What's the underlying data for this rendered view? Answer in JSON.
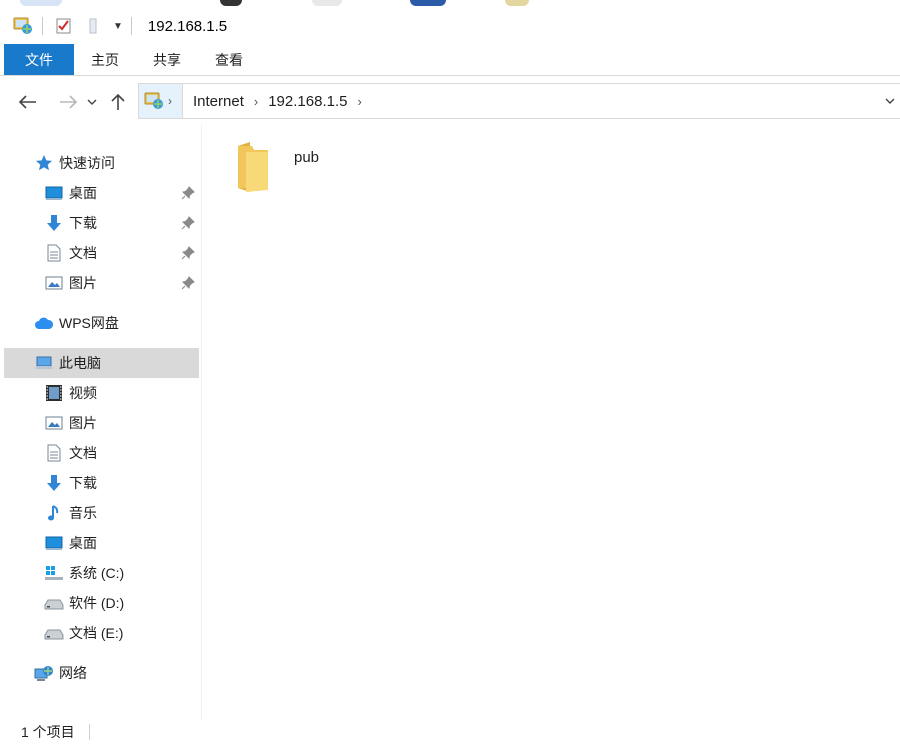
{
  "window": {
    "title": "192.168.1.5"
  },
  "ribbon": {
    "tabs": [
      {
        "label": "文件"
      },
      {
        "label": "主页"
      },
      {
        "label": "共享"
      },
      {
        "label": "查看"
      }
    ]
  },
  "address": {
    "crumbs": [
      "Internet",
      "192.168.1.5"
    ]
  },
  "nav": {
    "quick_access": "快速访问",
    "quick_items": [
      {
        "label": "桌面",
        "icon": "desktop-icon"
      },
      {
        "label": "下载",
        "icon": "download-icon"
      },
      {
        "label": "文档",
        "icon": "document-icon"
      },
      {
        "label": "图片",
        "icon": "pictures-icon"
      }
    ],
    "wps": "WPS网盘",
    "this_pc": "此电脑",
    "pc_items": [
      {
        "label": "视频",
        "icon": "video-icon"
      },
      {
        "label": "图片",
        "icon": "pictures-icon"
      },
      {
        "label": "文档",
        "icon": "document-icon"
      },
      {
        "label": "下载",
        "icon": "download-icon"
      },
      {
        "label": "音乐",
        "icon": "music-icon"
      },
      {
        "label": "桌面",
        "icon": "desktop-icon"
      },
      {
        "label": "系统 (C:)",
        "icon": "system-drive-icon"
      },
      {
        "label": "软件 (D:)",
        "icon": "drive-icon"
      },
      {
        "label": "文档 (E:)",
        "icon": "drive-icon"
      }
    ],
    "network": "网络"
  },
  "content": {
    "items": [
      {
        "name": "pub",
        "icon": "folder-icon"
      }
    ]
  },
  "status": {
    "count": "1 个项目"
  },
  "colors": {
    "accent": "#1979ca",
    "folder": "#f8d36a",
    "selected_bg": "#d9d9d9"
  }
}
